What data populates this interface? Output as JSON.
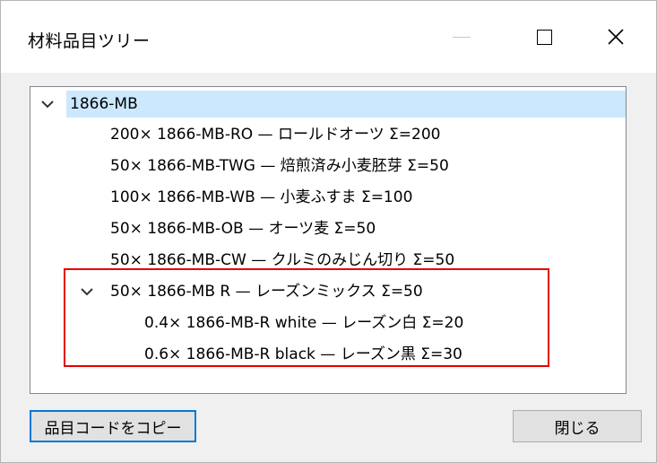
{
  "window": {
    "title": "材料品目ツリー",
    "min_label": "—",
    "close_label": "✕"
  },
  "tree": {
    "root": {
      "label": "1866-MB",
      "expanded": true,
      "selected": true
    },
    "children": [
      {
        "label": "200× 1866-MB-RO — ロールドオーツ Σ=200"
      },
      {
        "label": "50× 1866-MB-TWG — 焙煎済み小麦胚芽 Σ=50"
      },
      {
        "label": "100× 1866-MB-WB — 小麦ふすま Σ=100"
      },
      {
        "label": "50× 1866-MB-OB — オーツ麦 Σ=50"
      },
      {
        "label": "50× 1866-MB-CW — クルミのみじん切り Σ=50"
      },
      {
        "label": "50× 1866-MB R — レーズンミックス Σ=50",
        "expanded": true,
        "children": [
          {
            "label": "0.4× 1866-MB-R white — レーズン白 Σ=20"
          },
          {
            "label": "0.6× 1866-MB-R black — レーズン黒 Σ=30"
          }
        ]
      }
    ]
  },
  "buttons": {
    "copy_code": "品目コードをコピー",
    "close": "閉じる"
  },
  "colors": {
    "selection": "#cce8ff",
    "highlight_box": "#e60000",
    "focus_border": "#0078d7"
  }
}
